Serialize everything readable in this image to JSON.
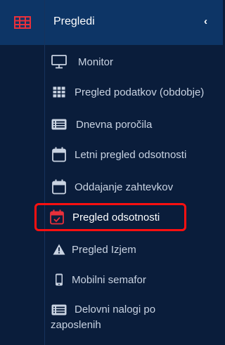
{
  "header": {
    "title": "Pregledi",
    "collapse_symbol": "‹"
  },
  "menu": [
    {
      "label": "Monitor",
      "icon": "monitor-icon"
    },
    {
      "label": "Pregled podatkov (obdobje)",
      "icon": "table-grid-icon"
    },
    {
      "label": "Dnevna poročila",
      "icon": "list-card-icon"
    },
    {
      "label": "Letni pregled odsotnosti",
      "icon": "calendar-icon"
    },
    {
      "label": "Oddajanje zahtevkov",
      "icon": "calendar-icon"
    },
    {
      "label": "Pregled odsotnosti",
      "icon": "calendar-check-icon",
      "active": true
    },
    {
      "label": "Pregled Izjem",
      "icon": "warning-icon"
    },
    {
      "label": "Mobilni semafor",
      "icon": "mobile-icon"
    },
    {
      "label": "Delovni nalogi po zaposlenih",
      "icon": "list-card-icon"
    }
  ],
  "colors": {
    "background": "#0a1d3b",
    "header": "#0d3566",
    "highlight": "#ff1010",
    "text": "#c9d3e2"
  }
}
